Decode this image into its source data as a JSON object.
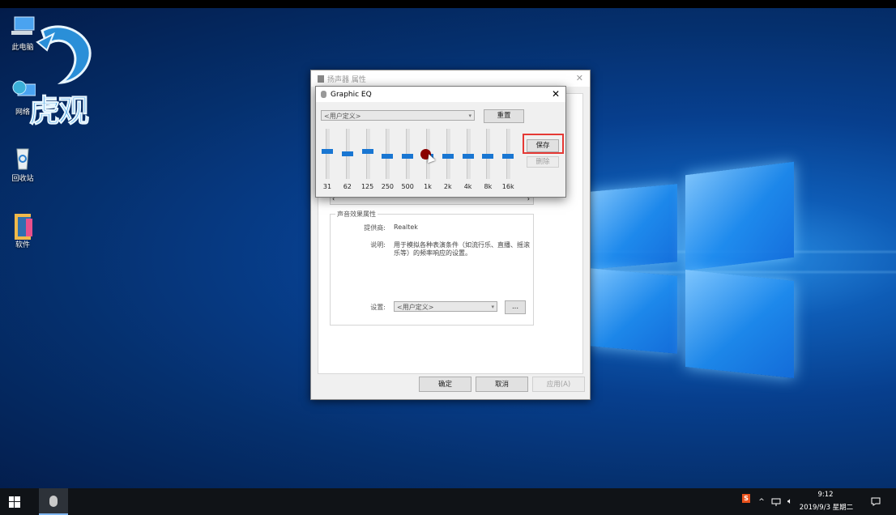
{
  "desktop": {
    "icons": [
      {
        "label": "此电脑"
      },
      {
        "label": "网络"
      },
      {
        "label": "回收站"
      },
      {
        "label": "软件"
      }
    ],
    "watermark_text": "虎观"
  },
  "props_dialog": {
    "title": "扬声器 属性",
    "group_title": "声音效果属性",
    "provider_label": "提供商:",
    "provider_value": "Realtek",
    "description_label": "说明:",
    "description_line1": "用于模拟各种表演条件（如流行乐、直播、摇滚",
    "description_line2": "乐等）的频率响应的设置。",
    "settings_label": "设置:",
    "settings_value": "<用户定义>",
    "more_button": "...",
    "ok_button": "确定",
    "cancel_button": "取消",
    "apply_button": "应用(A)"
  },
  "eq_dialog": {
    "title": "Graphic EQ",
    "preset_value": "<用户定义>",
    "reset_button": "重置",
    "save_button": "保存",
    "delete_button": "删除",
    "bands": [
      {
        "freq": "31",
        "level": 0.55
      },
      {
        "freq": "62",
        "level": 0.5
      },
      {
        "freq": "125",
        "level": 0.55
      },
      {
        "freq": "250",
        "level": 0.45
      },
      {
        "freq": "500",
        "level": 0.45
      },
      {
        "freq": "1k",
        "level": 0.45
      },
      {
        "freq": "2k",
        "level": 0.45
      },
      {
        "freq": "4k",
        "level": 0.45
      },
      {
        "freq": "8k",
        "level": 0.45
      },
      {
        "freq": "16k",
        "level": 0.45
      }
    ]
  },
  "taskbar": {
    "time": "9:12",
    "date": "2019/9/3 星期二",
    "ime_label": "S"
  }
}
